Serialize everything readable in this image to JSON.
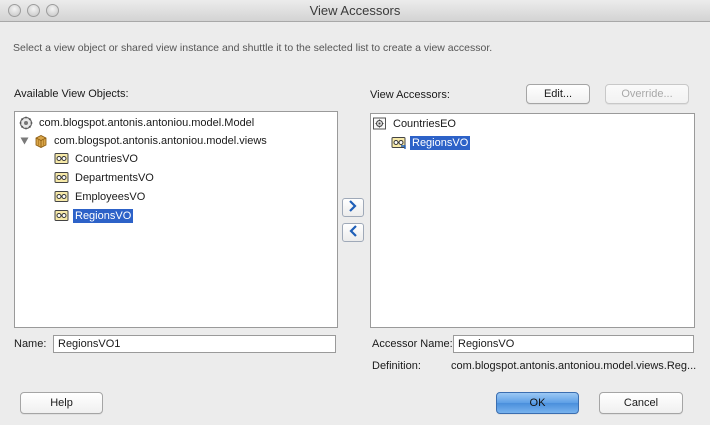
{
  "window": {
    "title": "View Accessors"
  },
  "instruction": "Select a view object or shared view instance and shuttle it to the selected list to create a view accessor.",
  "left": {
    "label": "Available View Objects:",
    "root": {
      "label": "com.blogspot.antonis.antoniou.model.Model",
      "icon": "model-icon"
    },
    "package": {
      "label": "com.blogspot.antonis.antoniou.model.views",
      "icon": "package-icon",
      "expanded": true
    },
    "items": [
      {
        "label": "CountriesVO",
        "icon": "view-object-icon",
        "selected": false
      },
      {
        "label": "DepartmentsVO",
        "icon": "view-object-icon",
        "selected": false
      },
      {
        "label": "EmployeesVO",
        "icon": "view-object-icon",
        "selected": false
      },
      {
        "label": "RegionsVO",
        "icon": "view-object-icon",
        "selected": true
      }
    ],
    "name_label": "Name:",
    "name_value": "RegionsVO1"
  },
  "right": {
    "label": "View Accessors:",
    "edit_label": "Edit...",
    "override_label": "Override...",
    "root": {
      "label": "CountriesEO",
      "icon": "entity-object-icon"
    },
    "items": [
      {
        "label": "RegionsVO",
        "icon": "view-accessor-icon",
        "selected": true
      }
    ],
    "accessor_name_label": "Accessor Name:",
    "accessor_name_value": "RegionsVO",
    "definition_label": "Definition:",
    "definition_value": "com.blogspot.antonis.antoniou.model.views.Reg..."
  },
  "shuttle": {
    "add_icon": "chevron-right-icon",
    "remove_icon": "chevron-left-icon"
  },
  "footer": {
    "help_label": "Help",
    "ok_label": "OK",
    "cancel_label": "Cancel"
  },
  "colors": {
    "selection": "#2d62c8",
    "primary_button": "#5d9fe6",
    "window_bg": "#ececec"
  }
}
